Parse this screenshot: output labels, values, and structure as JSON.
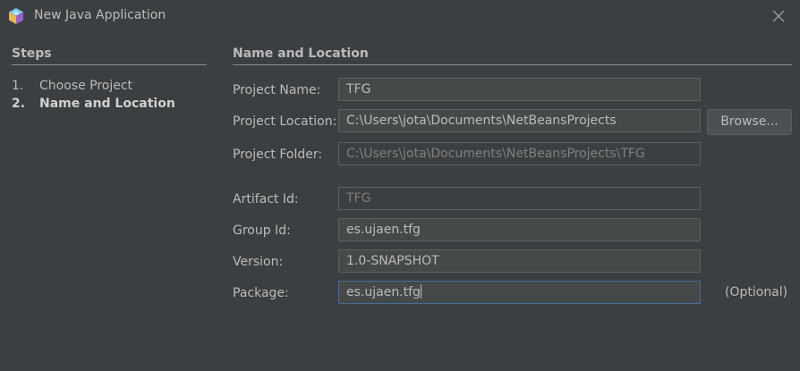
{
  "window": {
    "title": "New Java Application"
  },
  "steps": {
    "title": "Steps",
    "items": [
      {
        "number": "1.",
        "label": "Choose Project",
        "current": false
      },
      {
        "number": "2.",
        "label": "Name and Location",
        "current": true
      }
    ]
  },
  "main": {
    "title": "Name and Location",
    "fields": {
      "project_name": {
        "label": "Project Name:",
        "value": "TFG"
      },
      "project_location": {
        "label": "Project Location:",
        "value": "C:\\Users\\jota\\Documents\\NetBeansProjects"
      },
      "project_folder": {
        "label": "Project Folder:",
        "value": "C:\\Users\\jota\\Documents\\NetBeansProjects\\TFG"
      },
      "artifact_id": {
        "label": "Artifact Id:",
        "value": "TFG"
      },
      "group_id": {
        "label": "Group Id:",
        "value": "es.ujaen.tfg"
      },
      "version": {
        "label": "Version:",
        "value": "1.0-SNAPSHOT"
      },
      "package": {
        "label": "Package:",
        "value": "es.ujaen.tfg"
      }
    },
    "browse_label": "Browse...",
    "optional_label": "(Optional)"
  },
  "colors": {
    "background": "#3c3f41",
    "input_background": "#45494a",
    "input_border": "#5e6060",
    "focus_border": "#466d94",
    "text": "#bbbbbb",
    "disabled_text": "#7f7f7f"
  },
  "icons": {
    "app": "netbeans-cube-icon",
    "close": "close-icon"
  }
}
